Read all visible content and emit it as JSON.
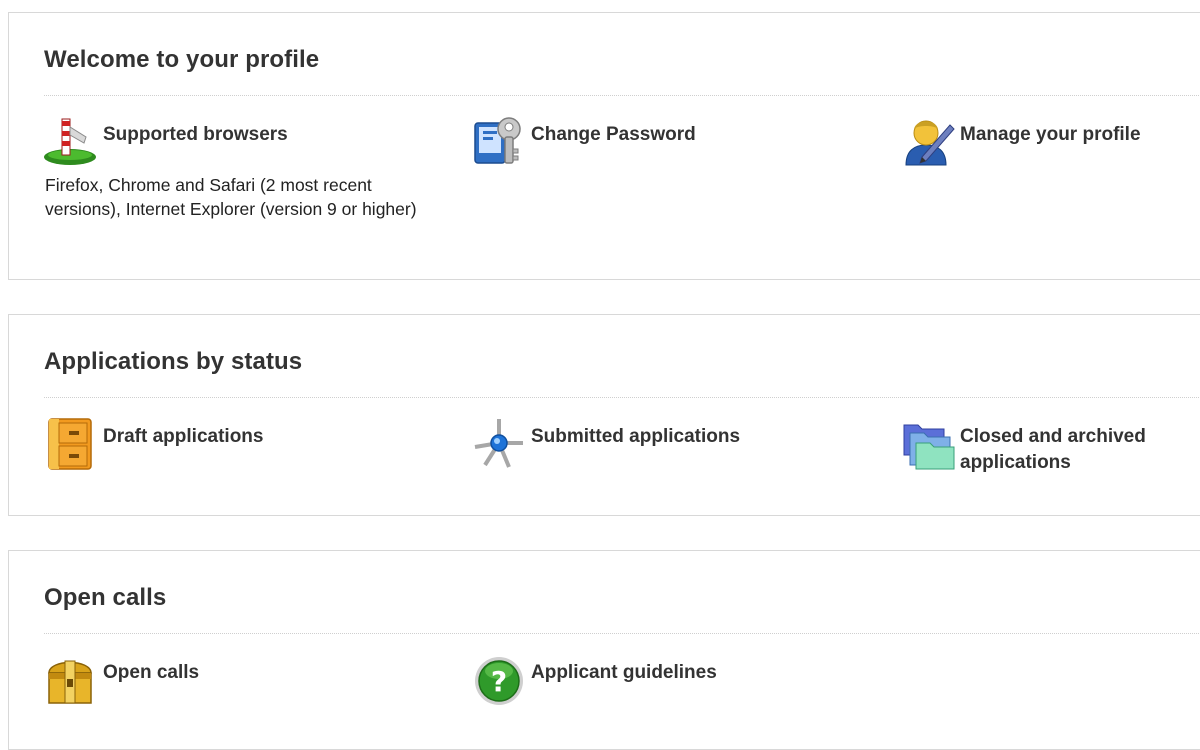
{
  "profile": {
    "title": "Welcome to your profile",
    "items": [
      {
        "label": "Supported browsers",
        "icon": "signpost-icon",
        "description": "Firefox, Chrome and Safari (2 most recent versions), Internet Explorer (version 9 or higher)"
      },
      {
        "label": "Change Password",
        "icon": "key-lock-icon"
      },
      {
        "label": "Manage your profile",
        "icon": "user-edit-icon"
      }
    ]
  },
  "status": {
    "title": "Applications by status",
    "items": [
      {
        "label": "Draft applications",
        "icon": "cabinet-icon"
      },
      {
        "label": "Submitted applications",
        "icon": "network-node-icon"
      },
      {
        "label": "Closed and archived applications",
        "icon": "folders-icon"
      }
    ]
  },
  "calls": {
    "title": "Open calls",
    "items": [
      {
        "label": "Open calls",
        "icon": "treasure-chest-icon"
      },
      {
        "label": "Applicant guidelines",
        "icon": "help-icon"
      }
    ]
  }
}
